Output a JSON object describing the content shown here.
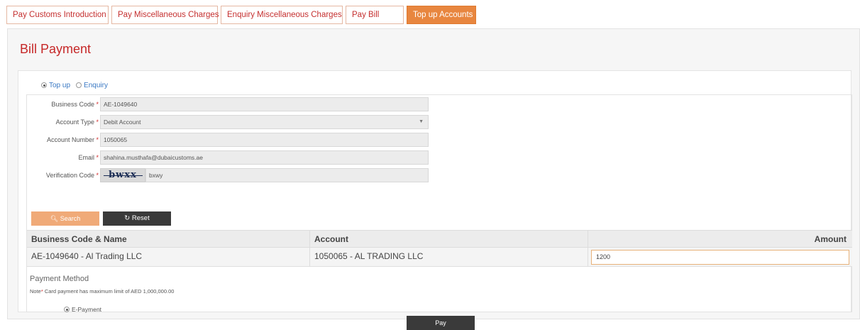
{
  "tabs": [
    {
      "label": "Pay Customs Introduction",
      "active": false
    },
    {
      "label": "Pay Miscellaneous Charges",
      "active": false
    },
    {
      "label": "Enquiry Miscellaneous Charges",
      "active": false
    },
    {
      "label": "Pay Bill",
      "active": false
    },
    {
      "label": "Top up Accounts",
      "active": true
    }
  ],
  "page": {
    "title": "Bill Payment"
  },
  "mode": {
    "topup_label": "Top up",
    "enquiry_label": "Enquiry",
    "selected": "Top up"
  },
  "form": {
    "business_code": {
      "label": "Business Code",
      "value": "AE-1049640"
    },
    "account_type": {
      "label": "Account Type",
      "value": "Debit Account"
    },
    "account_number": {
      "label": "Account Number",
      "value": "1050065"
    },
    "email": {
      "label": "Email",
      "value": "shahina.musthafa@dubaicustoms.ae"
    },
    "verification": {
      "label": "Verification Code",
      "captcha_text": "bwxx",
      "value": "bxwy"
    },
    "required_mark": "*"
  },
  "buttons": {
    "search": "Search",
    "reset": "Reset",
    "pay": "Pay"
  },
  "table": {
    "headers": [
      "Business Code & Name",
      "Account",
      "Amount"
    ],
    "rows": [
      {
        "business": "AE-1049640 - Al Trading LLC",
        "account": "1050065 - AL TRADING LLC",
        "amount": "1200"
      }
    ]
  },
  "payment": {
    "label": "Payment Method",
    "note_prefix": "Note",
    "note_text": " Card payment has maximum limit of AED 1,000,000.00",
    "option": "E-Payment"
  },
  "colors": {
    "accent": "#e8863f",
    "title": "#c62828",
    "dark_button": "#3a3a3a"
  }
}
